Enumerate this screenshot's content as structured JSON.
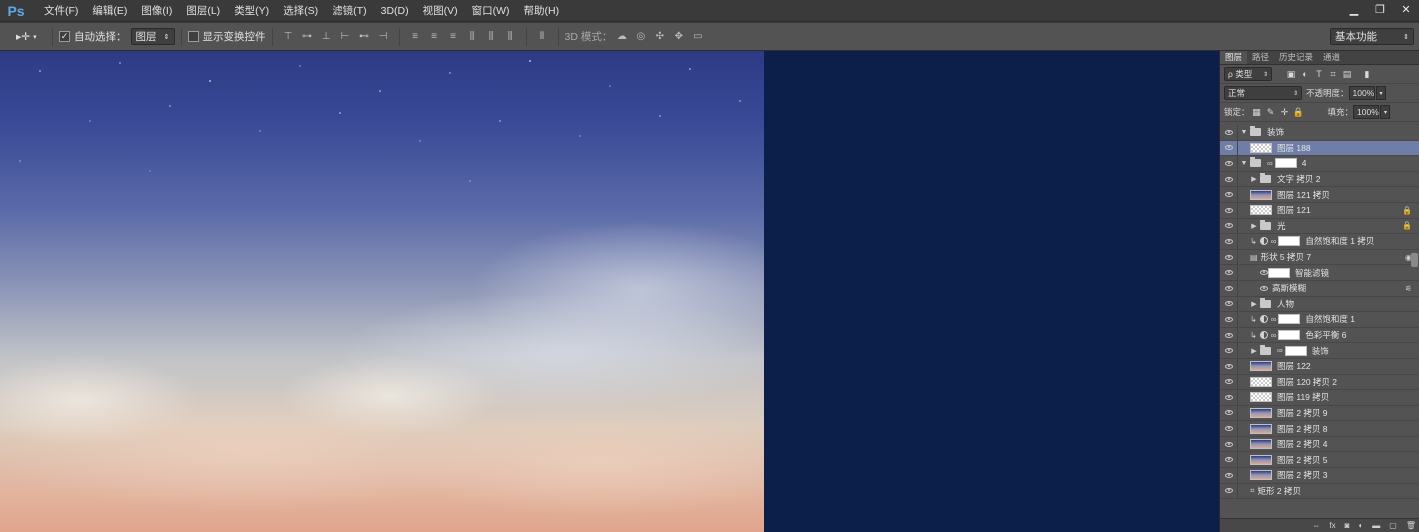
{
  "app": {
    "logo": "Ps",
    "menu": [
      "文件(F)",
      "编辑(E)",
      "图像(I)",
      "图层(L)",
      "类型(Y)",
      "选择(S)",
      "滤镜(T)",
      "3D(D)",
      "视图(V)",
      "窗口(W)",
      "帮助(H)"
    ],
    "window_controls": {
      "minimize": "▁",
      "restore": "❐",
      "close": "✕"
    }
  },
  "options": {
    "auto_select_label": "自动选择：",
    "auto_select_checked": true,
    "auto_select_value": "图层",
    "show_transform_label": "显示变换控件",
    "show_transform_checked": false,
    "mode_3d_label": "3D 模式：",
    "workspace": "基本功能"
  },
  "panel": {
    "tabs": [
      "图层",
      "路径",
      "历史记录",
      "通道"
    ],
    "filter_kind": "ρ 类型",
    "blend_mode": "正常",
    "opacity_label": "不透明度：",
    "opacity_value": "100%",
    "lock_label": "锁定：",
    "fill_label": "填充：",
    "fill_value": "100%"
  },
  "layers": [
    {
      "name": "装饰",
      "kind": "group-open",
      "indent": 0
    },
    {
      "name": "图层 188",
      "kind": "thumb",
      "indent": 1,
      "selected": true
    },
    {
      "name": "4",
      "kind": "group-open-mask",
      "indent": 0
    },
    {
      "name": "文字 拷贝 2",
      "kind": "group",
      "indent": 1
    },
    {
      "name": "图层 121 拷贝",
      "kind": "sky",
      "indent": 1
    },
    {
      "name": "图层 121",
      "kind": "thumb",
      "indent": 1,
      "lock": true
    },
    {
      "name": "光",
      "kind": "group",
      "indent": 1,
      "lock": true
    },
    {
      "name": "自然饱和度 1 拷贝",
      "kind": "adjust",
      "indent": 1
    },
    {
      "name": "形状 5 拷贝 7",
      "kind": "smart",
      "indent": 1
    },
    {
      "name": "智能滤镜",
      "kind": "filter-head",
      "indent": 2
    },
    {
      "name": "高斯模糊",
      "kind": "filter",
      "indent": 2
    },
    {
      "name": "人物",
      "kind": "group",
      "indent": 1
    },
    {
      "name": "自然饱和度 1",
      "kind": "adjust",
      "indent": 1
    },
    {
      "name": "色彩平衡 6",
      "kind": "adjust",
      "indent": 1
    },
    {
      "name": "装饰",
      "kind": "group-mask",
      "indent": 1
    },
    {
      "name": "图层 122",
      "kind": "sky",
      "indent": 1
    },
    {
      "name": "图层 120 拷贝 2",
      "kind": "thumb",
      "indent": 1
    },
    {
      "name": "图层 119 拷贝",
      "kind": "thumb",
      "indent": 1
    },
    {
      "name": "图层 2 拷贝 9",
      "kind": "sky",
      "indent": 1
    },
    {
      "name": "图层 2 拷贝 8",
      "kind": "sky",
      "indent": 1
    },
    {
      "name": "图层 2 拷贝 4",
      "kind": "sky",
      "indent": 1
    },
    {
      "name": "图层 2 拷贝 5",
      "kind": "sky",
      "indent": 1
    },
    {
      "name": "图层 2 拷贝 3",
      "kind": "sky",
      "indent": 1
    },
    {
      "name": "矩形 2 拷贝",
      "kind": "shape",
      "indent": 1
    }
  ],
  "colors": {
    "canvas_dark": "#0c1f4b",
    "selection": "#6e7ea6"
  }
}
